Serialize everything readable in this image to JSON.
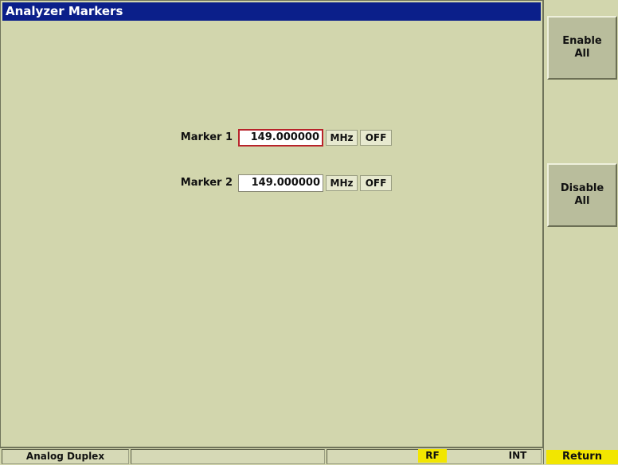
{
  "window": {
    "title": "Analyzer Markers"
  },
  "markers": [
    {
      "label": "Marker 1",
      "value": "149.000000",
      "unit": "MHz",
      "state": "OFF",
      "selected": true
    },
    {
      "label": "Marker 2",
      "value": "149.000000",
      "unit": "MHz",
      "state": "OFF",
      "selected": false
    }
  ],
  "softkeys": {
    "enable_all": {
      "line1": "Enable",
      "line2": "All"
    },
    "disable_all": {
      "line1": "Disable",
      "line2": "All"
    },
    "return": "Return"
  },
  "status_bar": {
    "mode": "Analog Duplex",
    "rf": "RF",
    "int": "INT"
  },
  "colors": {
    "title_bar": "#0b1f8a",
    "background": "#d2d6ad",
    "highlight": "#f2e600",
    "selected_border": "#b8232a"
  }
}
